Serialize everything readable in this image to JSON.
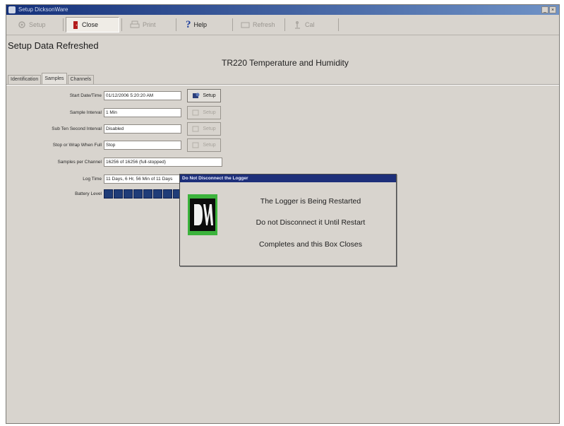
{
  "window": {
    "title": "Setup DicksonWare",
    "controls": [
      "_",
      "×"
    ]
  },
  "toolbar": {
    "buttons": [
      {
        "label": "Setup",
        "icon": "setup-icon",
        "enabled": false
      },
      {
        "label": "Close",
        "icon": "close-door-icon",
        "enabled": true,
        "pressed": true
      },
      {
        "label": "Print",
        "icon": "printer-icon",
        "enabled": false
      },
      {
        "label": "Help",
        "icon": "help-icon",
        "enabled": true
      },
      {
        "label": "Refresh",
        "icon": "refresh-icon",
        "enabled": false
      },
      {
        "label": "Cal",
        "icon": "calibrate-icon",
        "enabled": false
      }
    ]
  },
  "status_message": "Setup Data Refreshed",
  "device_title": "TR220 Temperature and Humidity",
  "tabs": [
    {
      "label": "Identification",
      "active": false
    },
    {
      "label": "Samples",
      "active": true
    },
    {
      "label": "Channels",
      "active": false
    }
  ],
  "form": {
    "start": {
      "label": "Start Date/Time",
      "value": "01/12/2006 5:20:20 AM",
      "button": "Setup"
    },
    "interval": {
      "label": "Sample Interval",
      "value": "1 Min",
      "button": "Setup"
    },
    "subten": {
      "label": "Sub Ten Second Interval",
      "value": "Disabled",
      "button": "Setup"
    },
    "stopwrap": {
      "label": "Stop or Wrap When Full",
      "value": "Stop",
      "button": "Setup"
    },
    "samples": {
      "label": "Samples per Channel",
      "value": "16256 of 16256 (full-stopped)"
    },
    "logtime": {
      "label": "Log Time",
      "value": "11 Days, 6 Hr, 56 Min of 11 Days"
    },
    "battery": {
      "label": "Battery Level",
      "bars": 8
    }
  },
  "dialog": {
    "title": "Do Not Disconnect the Logger",
    "line1": "The Logger is Being Restarted",
    "line2": "Do not Disconnect it Until Restart",
    "line3": "Completes and this Box Closes",
    "logo_alt": "DW"
  },
  "colors": {
    "titlebar": "#14307a",
    "window_bg": "#d8d4ce",
    "battery": "#1f3c78",
    "dialog_title": "#1d2f7a",
    "logo_green": "#3cb33c"
  }
}
